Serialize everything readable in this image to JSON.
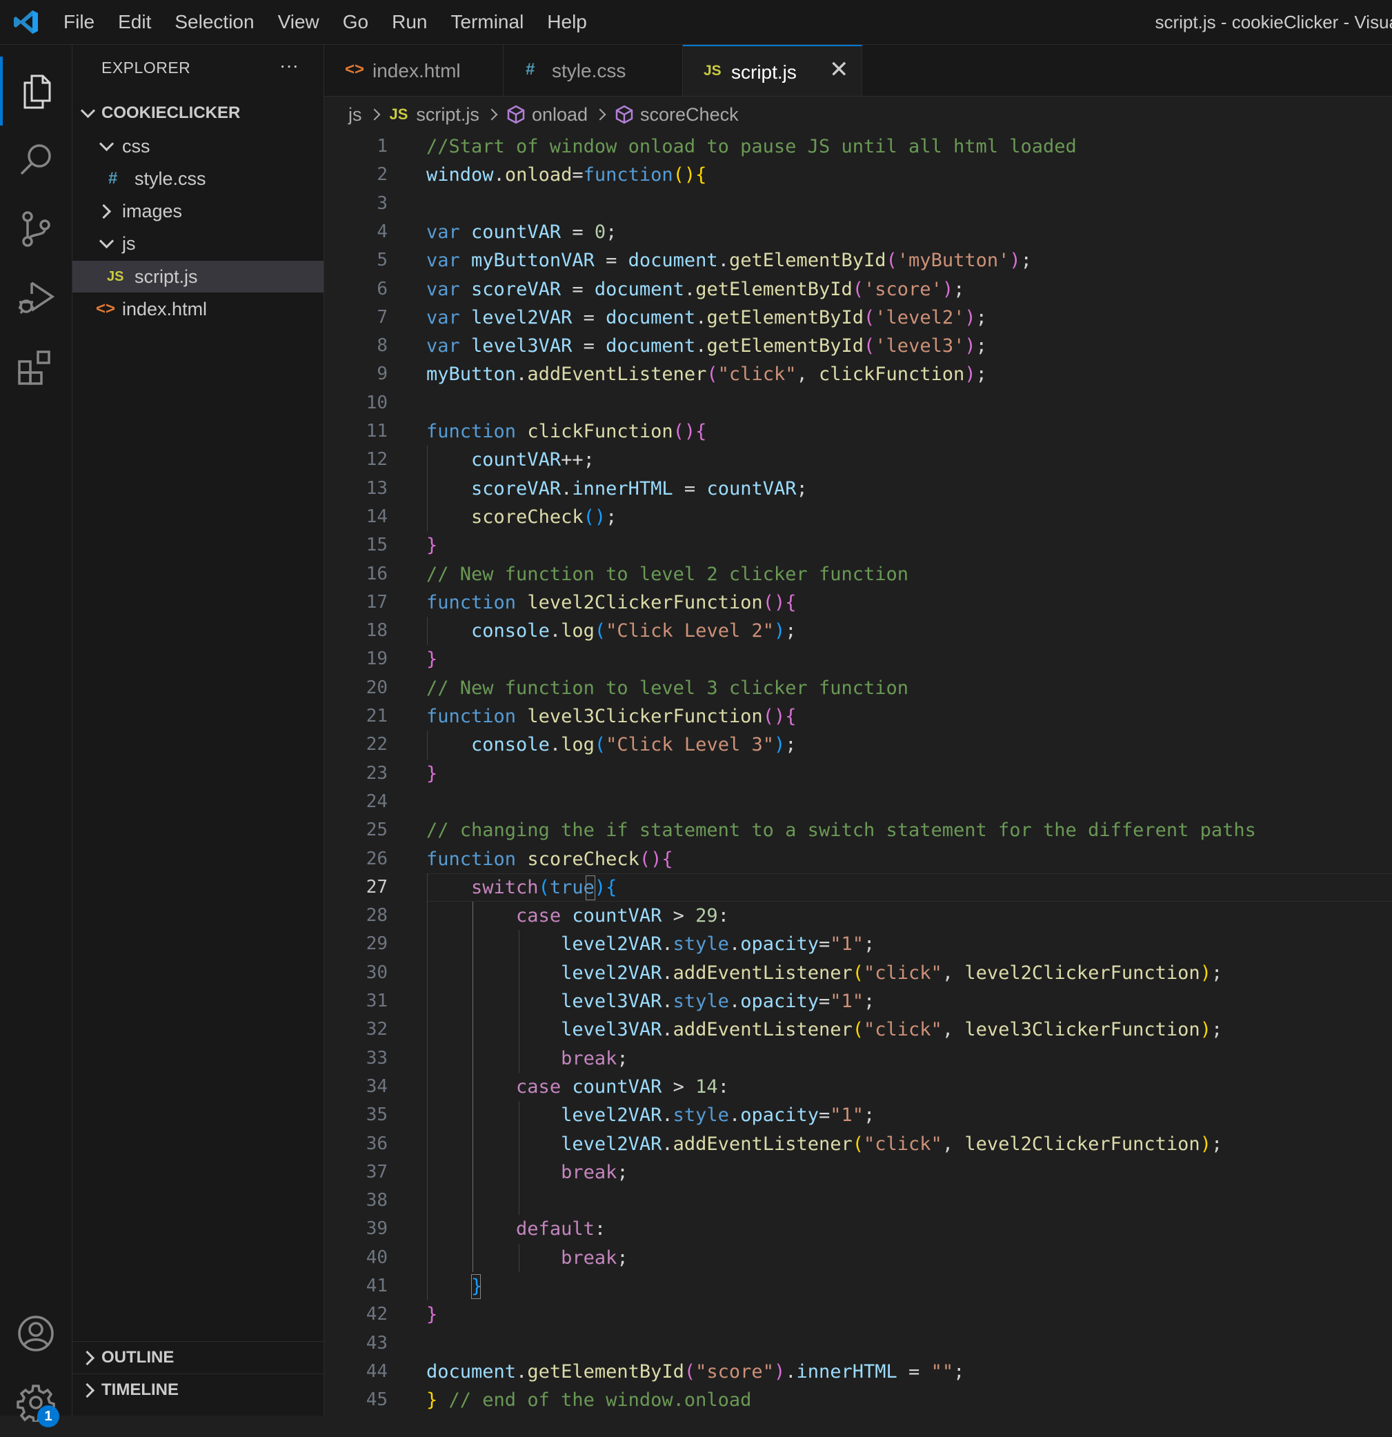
{
  "titlebar": {
    "menu": [
      "File",
      "Edit",
      "Selection",
      "View",
      "Go",
      "Run",
      "Terminal",
      "Help"
    ],
    "window_title": "script.js - cookieClicker - Visua"
  },
  "activity_bar": {
    "icons": [
      "explorer-icon",
      "search-icon",
      "source-control-icon",
      "run-debug-icon",
      "extensions-icon"
    ],
    "bottom_icons": [
      "account-icon",
      "settings-gear-icon"
    ],
    "settings_badge": "1",
    "accent": "#0078d4"
  },
  "sidebar": {
    "header": "EXPLORER",
    "more": "···",
    "project": "COOKIECLICKER",
    "tree": [
      {
        "label": "css",
        "type": "folder",
        "expanded": true,
        "depth": 1
      },
      {
        "label": "style.css",
        "type": "css",
        "icon": "#",
        "depth": 2
      },
      {
        "label": "images",
        "type": "folder",
        "expanded": false,
        "depth": 1
      },
      {
        "label": "js",
        "type": "folder",
        "expanded": true,
        "depth": 1
      },
      {
        "label": "script.js",
        "type": "js",
        "icon": "JS",
        "depth": 2,
        "selected": true
      },
      {
        "label": "index.html",
        "type": "html",
        "icon": "<>",
        "depth": 1
      }
    ],
    "outline": "OUTLINE",
    "timeline": "TIMELINE"
  },
  "tabs": [
    {
      "label": "index.html",
      "icon": "<>",
      "icon_color": "#e37933"
    },
    {
      "label": "style.css",
      "icon": "#",
      "icon_color": "#519aba"
    },
    {
      "label": "script.js",
      "icon": "JS",
      "icon_color": "#cbcb41",
      "active": true,
      "close": "✕"
    }
  ],
  "breadcrumb": [
    "js",
    "script.js",
    "onload",
    "scoreCheck"
  ],
  "editor": {
    "current_line": 27,
    "lines": [
      [
        [
          "c",
          "//Start of window onload to pause JS until all html loaded"
        ]
      ],
      [
        [
          "v",
          "window"
        ],
        [
          "pl",
          "."
        ],
        [
          "f",
          "onload"
        ],
        [
          "pl",
          "="
        ],
        [
          "k",
          "function"
        ],
        [
          "p1",
          "(){"
        ]
      ],
      [],
      [
        [
          "k",
          "var"
        ],
        [
          "pl",
          " "
        ],
        [
          "v",
          "countVAR"
        ],
        [
          "pl",
          " = "
        ],
        [
          "n",
          "0"
        ],
        [
          "pl",
          ";"
        ]
      ],
      [
        [
          "k",
          "var"
        ],
        [
          "pl",
          " "
        ],
        [
          "v",
          "myButtonVAR"
        ],
        [
          "pl",
          " = "
        ],
        [
          "v",
          "document"
        ],
        [
          "pl",
          "."
        ],
        [
          "f",
          "getElementById"
        ],
        [
          "p2",
          "("
        ],
        [
          "s",
          "'myButton'"
        ],
        [
          "p2",
          ")"
        ],
        [
          "pl",
          ";"
        ]
      ],
      [
        [
          "k",
          "var"
        ],
        [
          "pl",
          " "
        ],
        [
          "v",
          "scoreVAR"
        ],
        [
          "pl",
          " = "
        ],
        [
          "v",
          "document"
        ],
        [
          "pl",
          "."
        ],
        [
          "f",
          "getElementById"
        ],
        [
          "p2",
          "("
        ],
        [
          "s",
          "'score'"
        ],
        [
          "p2",
          ")"
        ],
        [
          "pl",
          ";"
        ]
      ],
      [
        [
          "k",
          "var"
        ],
        [
          "pl",
          " "
        ],
        [
          "v",
          "level2VAR"
        ],
        [
          "pl",
          " = "
        ],
        [
          "v",
          "document"
        ],
        [
          "pl",
          "."
        ],
        [
          "f",
          "getElementById"
        ],
        [
          "p2",
          "("
        ],
        [
          "s",
          "'level2'"
        ],
        [
          "p2",
          ")"
        ],
        [
          "pl",
          ";"
        ]
      ],
      [
        [
          "k",
          "var"
        ],
        [
          "pl",
          " "
        ],
        [
          "v",
          "level3VAR"
        ],
        [
          "pl",
          " = "
        ],
        [
          "v",
          "document"
        ],
        [
          "pl",
          "."
        ],
        [
          "f",
          "getElementById"
        ],
        [
          "p2",
          "("
        ],
        [
          "s",
          "'level3'"
        ],
        [
          "p2",
          ")"
        ],
        [
          "pl",
          ";"
        ]
      ],
      [
        [
          "v",
          "myButton"
        ],
        [
          "pl",
          "."
        ],
        [
          "f",
          "addEventListener"
        ],
        [
          "p2",
          "("
        ],
        [
          "s",
          "\"click\""
        ],
        [
          "pl",
          ", "
        ],
        [
          "f",
          "clickFunction"
        ],
        [
          "p2",
          ")"
        ],
        [
          "pl",
          ";"
        ]
      ],
      [],
      [
        [
          "k",
          "function"
        ],
        [
          "pl",
          " "
        ],
        [
          "f",
          "clickFunction"
        ],
        [
          "p2",
          "(){"
        ]
      ],
      [
        [
          "pl",
          "    "
        ],
        [
          "v",
          "countVAR"
        ],
        [
          "pl",
          "++;"
        ]
      ],
      [
        [
          "pl",
          "    "
        ],
        [
          "v",
          "scoreVAR"
        ],
        [
          "pl",
          "."
        ],
        [
          "v",
          "innerHTML"
        ],
        [
          "pl",
          " = "
        ],
        [
          "v",
          "countVAR"
        ],
        [
          "pl",
          ";"
        ]
      ],
      [
        [
          "pl",
          "    "
        ],
        [
          "f",
          "scoreCheck"
        ],
        [
          "p3",
          "()"
        ],
        [
          "pl",
          ";"
        ]
      ],
      [
        [
          "p2",
          "}"
        ]
      ],
      [
        [
          "c",
          "// New function to level 2 clicker function"
        ]
      ],
      [
        [
          "k",
          "function"
        ],
        [
          "pl",
          " "
        ],
        [
          "f",
          "level2ClickerFunction"
        ],
        [
          "p2",
          "(){"
        ]
      ],
      [
        [
          "pl",
          "    "
        ],
        [
          "v",
          "console"
        ],
        [
          "pl",
          "."
        ],
        [
          "f",
          "log"
        ],
        [
          "p3",
          "("
        ],
        [
          "s",
          "\"Click Level 2\""
        ],
        [
          "p3",
          ")"
        ],
        [
          "pl",
          ";"
        ]
      ],
      [
        [
          "p2",
          "}"
        ]
      ],
      [
        [
          "c",
          "// New function to level 3 clicker function"
        ]
      ],
      [
        [
          "k",
          "function"
        ],
        [
          "pl",
          " "
        ],
        [
          "f",
          "level3ClickerFunction"
        ],
        [
          "p2",
          "(){"
        ]
      ],
      [
        [
          "pl",
          "    "
        ],
        [
          "v",
          "console"
        ],
        [
          "pl",
          "."
        ],
        [
          "f",
          "log"
        ],
        [
          "p3",
          "("
        ],
        [
          "s",
          "\"Click Level 3\""
        ],
        [
          "p3",
          ")"
        ],
        [
          "pl",
          ";"
        ]
      ],
      [
        [
          "p2",
          "}"
        ]
      ],
      [],
      [
        [
          "c",
          "// changing the if statement to a switch statement for the different paths"
        ]
      ],
      [
        [
          "k",
          "function"
        ],
        [
          "pl",
          " "
        ],
        [
          "f",
          "scoreCheck"
        ],
        [
          "p2",
          "(){"
        ]
      ],
      [
        [
          "pl",
          "    "
        ],
        [
          "ctl",
          "switch"
        ],
        [
          "p3",
          "("
        ],
        [
          "k",
          "true"
        ],
        [
          "p3",
          ")"
        ],
        [
          "p3",
          "{"
        ]
      ],
      [
        [
          "pl",
          "        "
        ],
        [
          "ctl",
          "case"
        ],
        [
          "pl",
          " "
        ],
        [
          "v",
          "countVAR"
        ],
        [
          "pl",
          " > "
        ],
        [
          "n",
          "29"
        ],
        [
          "pl",
          ":"
        ]
      ],
      [
        [
          "pl",
          "            "
        ],
        [
          "v",
          "level2VAR"
        ],
        [
          "pl",
          "."
        ],
        [
          "k",
          "style"
        ],
        [
          "pl",
          "."
        ],
        [
          "v",
          "opacity"
        ],
        [
          "pl",
          "="
        ],
        [
          "s",
          "\"1\""
        ],
        [
          "pl",
          ";"
        ]
      ],
      [
        [
          "pl",
          "            "
        ],
        [
          "v",
          "level2VAR"
        ],
        [
          "pl",
          "."
        ],
        [
          "f",
          "addEventListener"
        ],
        [
          "p1",
          "("
        ],
        [
          "s",
          "\"click\""
        ],
        [
          "pl",
          ", "
        ],
        [
          "f",
          "level2ClickerFunction"
        ],
        [
          "p1",
          ")"
        ],
        [
          "pl",
          ";"
        ]
      ],
      [
        [
          "pl",
          "            "
        ],
        [
          "v",
          "level3VAR"
        ],
        [
          "pl",
          "."
        ],
        [
          "k",
          "style"
        ],
        [
          "pl",
          "."
        ],
        [
          "v",
          "opacity"
        ],
        [
          "pl",
          "="
        ],
        [
          "s",
          "\"1\""
        ],
        [
          "pl",
          ";"
        ]
      ],
      [
        [
          "pl",
          "            "
        ],
        [
          "v",
          "level3VAR"
        ],
        [
          "pl",
          "."
        ],
        [
          "f",
          "addEventListener"
        ],
        [
          "p1",
          "("
        ],
        [
          "s",
          "\"click\""
        ],
        [
          "pl",
          ", "
        ],
        [
          "f",
          "level3ClickerFunction"
        ],
        [
          "p1",
          ")"
        ],
        [
          "pl",
          ";"
        ]
      ],
      [
        [
          "pl",
          "            "
        ],
        [
          "ctl",
          "break"
        ],
        [
          "pl",
          ";"
        ]
      ],
      [
        [
          "pl",
          "        "
        ],
        [
          "ctl",
          "case"
        ],
        [
          "pl",
          " "
        ],
        [
          "v",
          "countVAR"
        ],
        [
          "pl",
          " > "
        ],
        [
          "n",
          "14"
        ],
        [
          "pl",
          ":"
        ]
      ],
      [
        [
          "pl",
          "            "
        ],
        [
          "v",
          "level2VAR"
        ],
        [
          "pl",
          "."
        ],
        [
          "k",
          "style"
        ],
        [
          "pl",
          "."
        ],
        [
          "v",
          "opacity"
        ],
        [
          "pl",
          "="
        ],
        [
          "s",
          "\"1\""
        ],
        [
          "pl",
          ";"
        ]
      ],
      [
        [
          "pl",
          "            "
        ],
        [
          "v",
          "level2VAR"
        ],
        [
          "pl",
          "."
        ],
        [
          "f",
          "addEventListener"
        ],
        [
          "p1",
          "("
        ],
        [
          "s",
          "\"click\""
        ],
        [
          "pl",
          ", "
        ],
        [
          "f",
          "level2ClickerFunction"
        ],
        [
          "p1",
          ")"
        ],
        [
          "pl",
          ";"
        ]
      ],
      [
        [
          "pl",
          "            "
        ],
        [
          "ctl",
          "break"
        ],
        [
          "pl",
          ";"
        ]
      ],
      [],
      [
        [
          "pl",
          "        "
        ],
        [
          "ctl",
          "default"
        ],
        [
          "pl",
          ":"
        ]
      ],
      [
        [
          "pl",
          "            "
        ],
        [
          "ctl",
          "break"
        ],
        [
          "pl",
          ";"
        ]
      ],
      [
        [
          "pl",
          "    "
        ],
        [
          "p3",
          "}"
        ]
      ],
      [
        [
          "p2",
          "}"
        ]
      ],
      [],
      [
        [
          "v",
          "document"
        ],
        [
          "pl",
          "."
        ],
        [
          "f",
          "getElementById"
        ],
        [
          "p2",
          "("
        ],
        [
          "s",
          "\"score\""
        ],
        [
          "p2",
          ")"
        ],
        [
          "pl",
          "."
        ],
        [
          "v",
          "innerHTML"
        ],
        [
          "pl",
          " = "
        ],
        [
          "s",
          "\"\""
        ],
        [
          "pl",
          ";"
        ]
      ],
      [
        [
          "p1",
          "}"
        ],
        [
          "pl",
          " "
        ],
        [
          "c",
          "// end of the window.onload"
        ]
      ]
    ]
  }
}
